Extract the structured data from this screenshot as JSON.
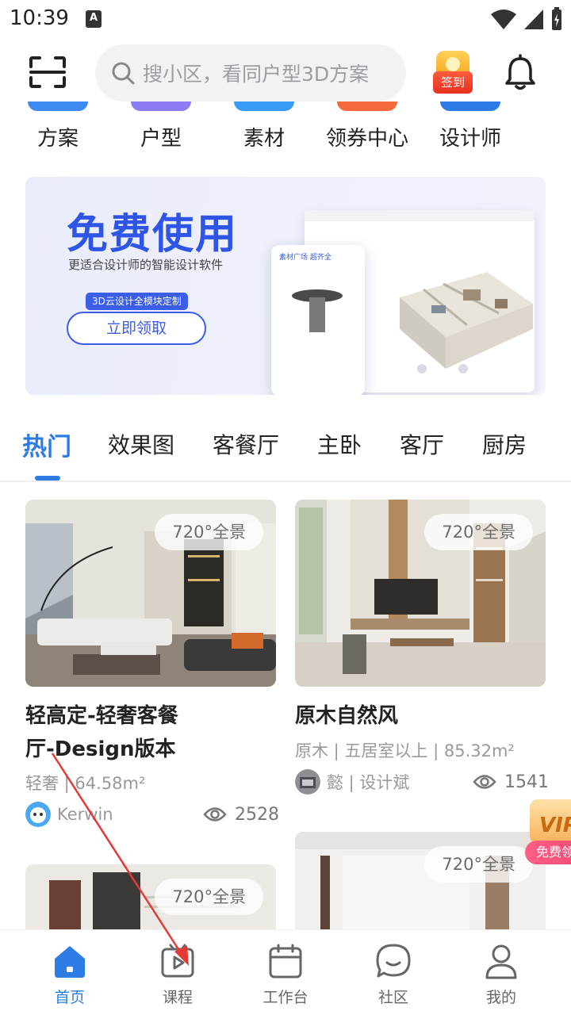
{
  "status_bar": {
    "time": "10:39",
    "notification_icon": "A"
  },
  "header": {
    "search_placeholder": "搜小区，看同户型3D方案",
    "checkin_label": "签到"
  },
  "categories": [
    {
      "label": "方案",
      "color": "#3d8bf0"
    },
    {
      "label": "户型",
      "color": "#8b7cf3"
    },
    {
      "label": "素材",
      "color": "#3a9bf5"
    },
    {
      "label": "领券中心",
      "color": "#f56a3c"
    },
    {
      "label": "设计师",
      "color": "#2d7be5"
    }
  ],
  "banner": {
    "title": "免费使用",
    "subtitle": "更适合设计师的智能设计软件",
    "badge": "3D云设计全模块定制",
    "cta": "立即领取",
    "panel_title": "素材广场 超齐全"
  },
  "tabs": [
    {
      "label": "热门",
      "active": true
    },
    {
      "label": "效果图"
    },
    {
      "label": "客餐厅"
    },
    {
      "label": "主卧"
    },
    {
      "label": "客厅"
    },
    {
      "label": "厨房"
    }
  ],
  "cards": [
    {
      "badge": "720°全景",
      "title_line1": "轻高定-轻奢客餐",
      "title_line2": "厅-Design版本",
      "meta": "轻奢 | 64.58m²",
      "author": "Kerwin",
      "views": "2528"
    },
    {
      "badge": "720°全景",
      "title_line1": "原木自然风",
      "meta": "原木 | 五居室以上 | 85.32m²",
      "author": "懿 | 设计斌",
      "views": "1541"
    },
    {
      "badge": "720°全景"
    },
    {
      "badge": "720°全景"
    }
  ],
  "vip_float": {
    "text": "VIP",
    "tag": "免费领"
  },
  "bottom_nav": [
    {
      "label": "首页",
      "active": true
    },
    {
      "label": "课程"
    },
    {
      "label": "工作台"
    },
    {
      "label": "社区"
    },
    {
      "label": "我的"
    }
  ],
  "colors": {
    "accent": "#2d7be5",
    "annotation_arrow": "#e53935"
  }
}
